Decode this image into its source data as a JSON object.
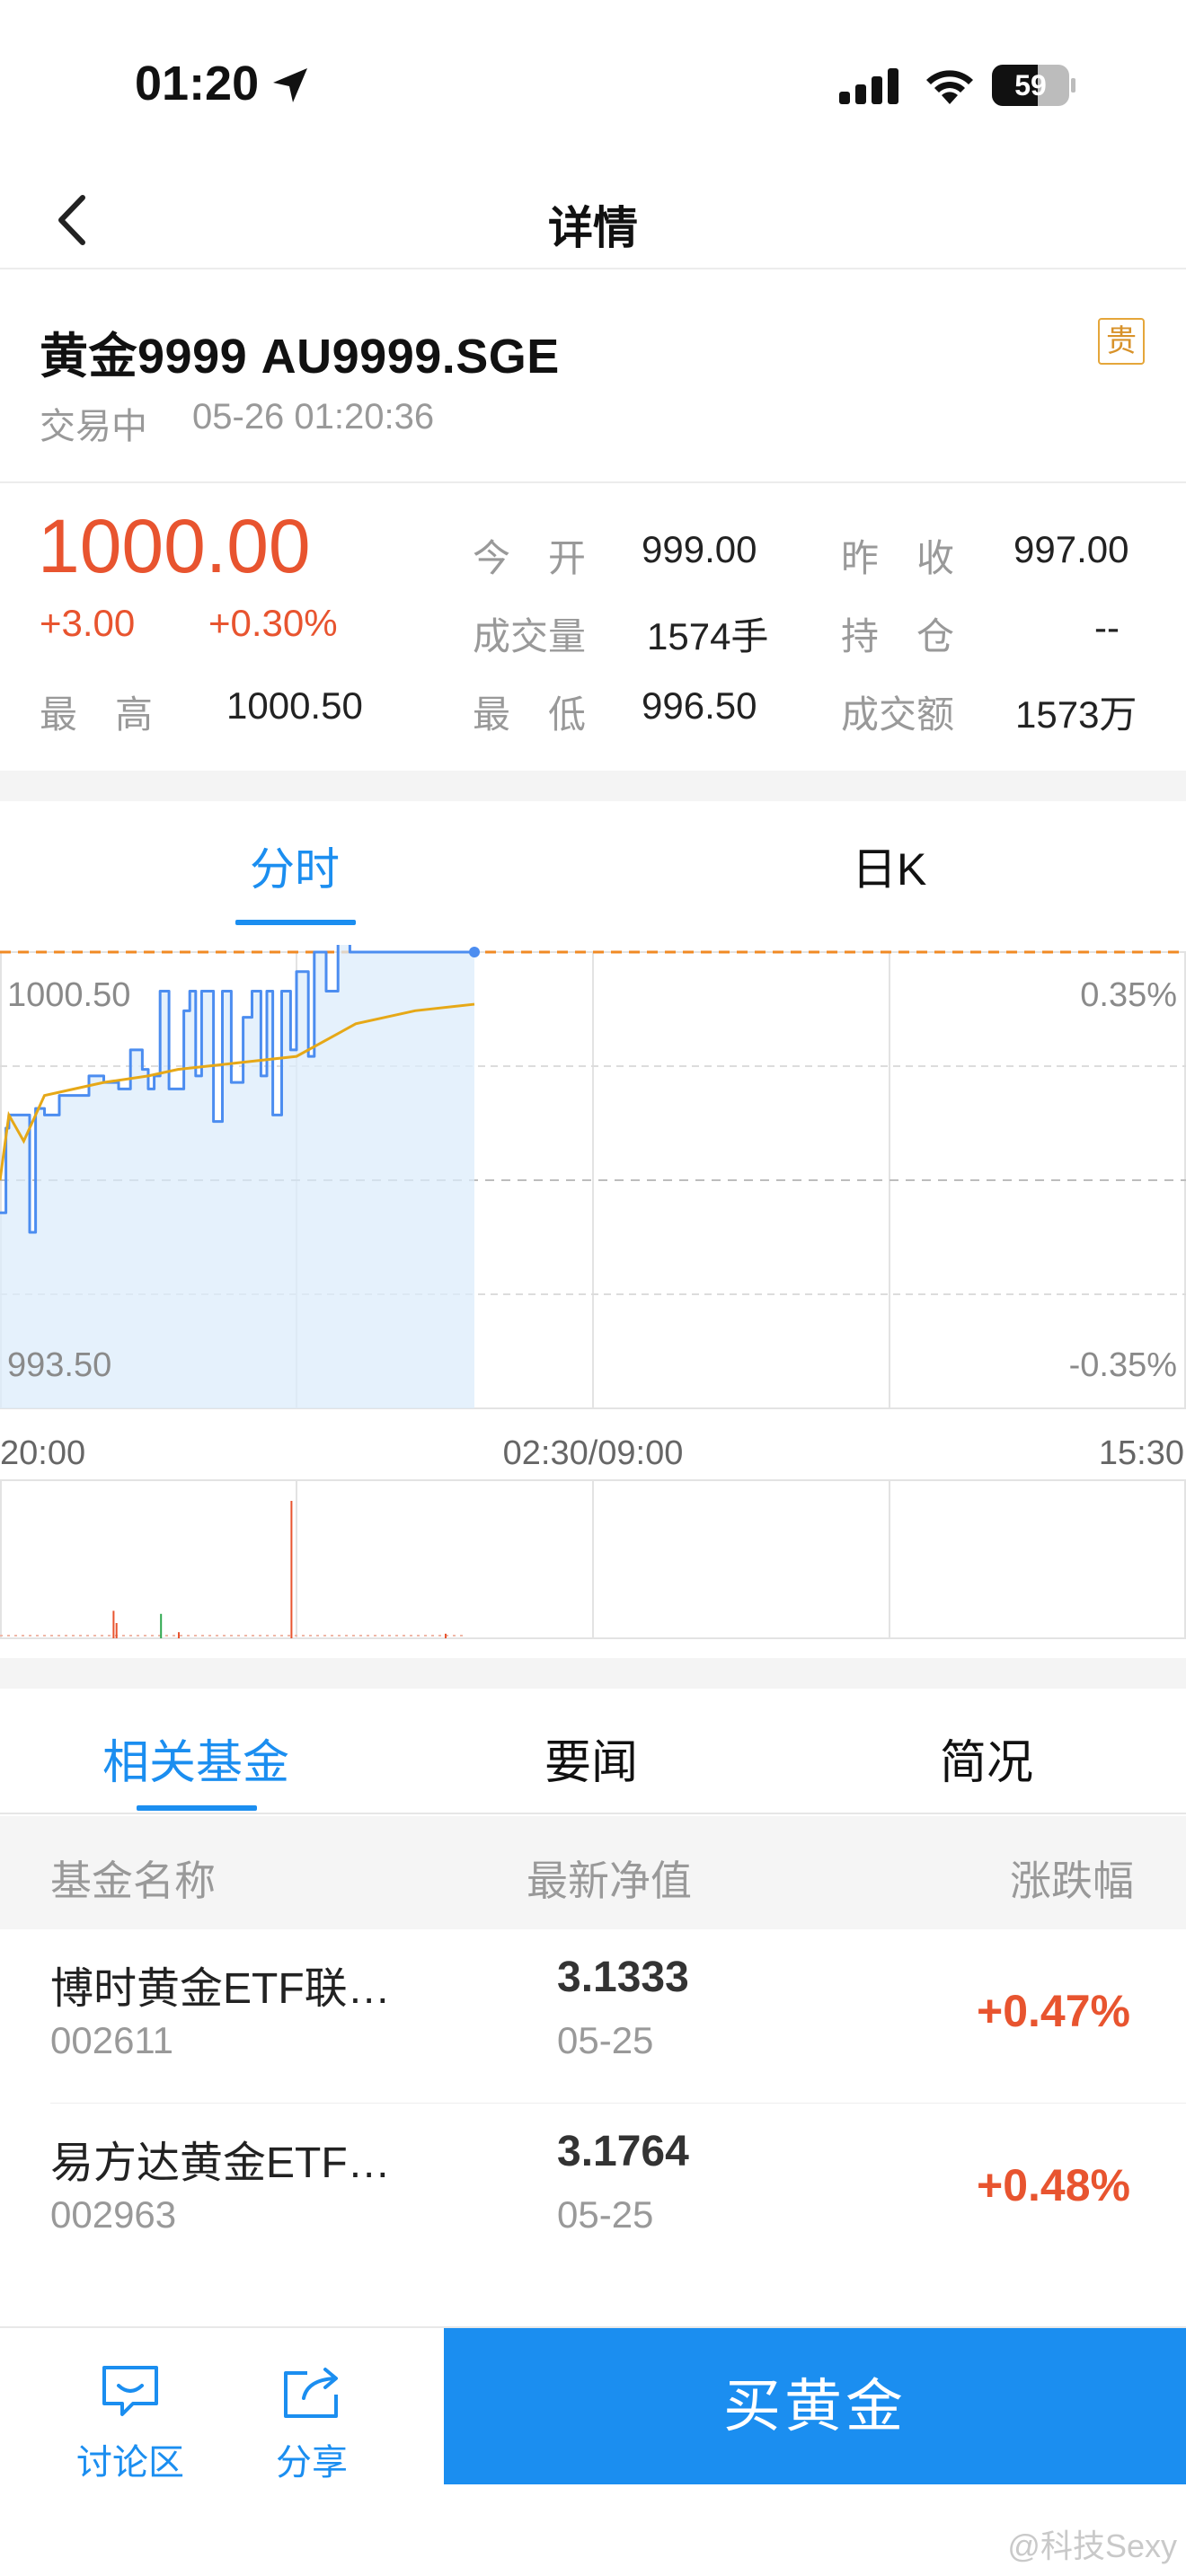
{
  "status_bar": {
    "time": "01:20",
    "battery": "59",
    "battery_level": 0.59
  },
  "nav": {
    "title": "详情"
  },
  "instrument": {
    "name": "黄金9999 AU9999.SGE",
    "status": "交易中",
    "datetime": "05-26 01:20:36",
    "badge": "贵"
  },
  "quote": {
    "price": "1000.00",
    "change": "+3.00",
    "change_pct": "+0.30%",
    "high_label": "最　高",
    "high": "1000.50",
    "open_label": "今　开",
    "open": "999.00",
    "prev_close_label": "昨　收",
    "prev_close": "997.00",
    "volume_label": "成交量",
    "volume": "1574手",
    "position_label": "持　仓",
    "position": "--",
    "low_label": "最　低",
    "low": "996.50",
    "turnover_label": "成交额",
    "turnover": "1573万"
  },
  "chart_tabs": {
    "intraday": "分时",
    "daily": "日K",
    "active": "分时"
  },
  "chart_data": {
    "type": "line",
    "y_top_label": "1000.50",
    "y_bottom_label": "993.50",
    "pct_top_label": "0.35%",
    "pct_bottom_label": "-0.35%",
    "ylim": [
      993.5,
      1000.5
    ],
    "reference": 997.0,
    "x_labels": [
      "20:00",
      "02:30/09:00",
      "15:30"
    ],
    "grid": true,
    "series": [
      {
        "key": "price",
        "color": "#4c8df0",
        "x": [
          0,
          2,
          3,
          10,
          12,
          15,
          20,
          30,
          35,
          40,
          44,
          48,
          50,
          52,
          54,
          57,
          62,
          64,
          66,
          68,
          72,
          75,
          78,
          82,
          85,
          88,
          90,
          92,
          95,
          98,
          100,
          104,
          106,
          110,
          114,
          118,
          120,
          130,
          160
        ],
        "y": [
          996.5,
          997.8,
          998.0,
          996.2,
          998.1,
          998.0,
          998.3,
          998.6,
          998.5,
          998.4,
          999.0,
          998.7,
          998.4,
          998.6,
          999.9,
          998.4,
          999.6,
          999.9,
          998.6,
          999.9,
          997.9,
          999.9,
          998.5,
          999.5,
          999.9,
          998.6,
          999.9,
          998.0,
          999.9,
          999.0,
          1000.2,
          998.9,
          1000.5,
          999.9,
          1000.7,
          1000.5,
          1000.5,
          1000.5,
          1000.5
        ]
      },
      {
        "key": "average",
        "color": "#e6a817",
        "x": [
          0,
          3,
          8,
          15,
          25,
          35,
          50,
          60,
          80,
          100,
          120,
          140,
          160
        ],
        "y": [
          997.0,
          998.0,
          997.6,
          998.3,
          998.4,
          998.5,
          998.6,
          998.7,
          998.8,
          998.9,
          999.4,
          999.6,
          999.7
        ]
      }
    ],
    "volume_bars": [
      {
        "x": 38,
        "v": 18,
        "color": "#e8542f"
      },
      {
        "x": 39,
        "v": 10,
        "color": "#e8542f"
      },
      {
        "x": 54,
        "v": 16,
        "color": "#2fa84f"
      },
      {
        "x": 60,
        "v": 4,
        "color": "#e8542f"
      },
      {
        "x": 98,
        "v": 90,
        "color": "#e8542f"
      },
      {
        "x": 150,
        "v": 3,
        "color": "#e8542f"
      }
    ],
    "x_total": 400
  },
  "lower_tabs": {
    "funds": "相关基金",
    "news": "要闻",
    "overview": "简况"
  },
  "fund_table": {
    "headers": [
      "基金名称",
      "最新净值",
      "涨跌幅"
    ],
    "rows": [
      {
        "name": "博时黄金ETF联…",
        "code": "002611",
        "nav": "3.1333",
        "date": "05-25",
        "change": "+0.47%"
      },
      {
        "name": "易方达黄金ETF…",
        "code": "002963",
        "nav": "3.1764",
        "date": "05-25",
        "change": "+0.48%"
      }
    ]
  },
  "bottom_bar": {
    "discuss": "讨论区",
    "share": "分享",
    "buy": "买黄金"
  },
  "watermark": "@科技Sexy",
  "colors": {
    "accent": "#1b8ef0",
    "up": "#e8542f",
    "down": "#2fa84f"
  }
}
